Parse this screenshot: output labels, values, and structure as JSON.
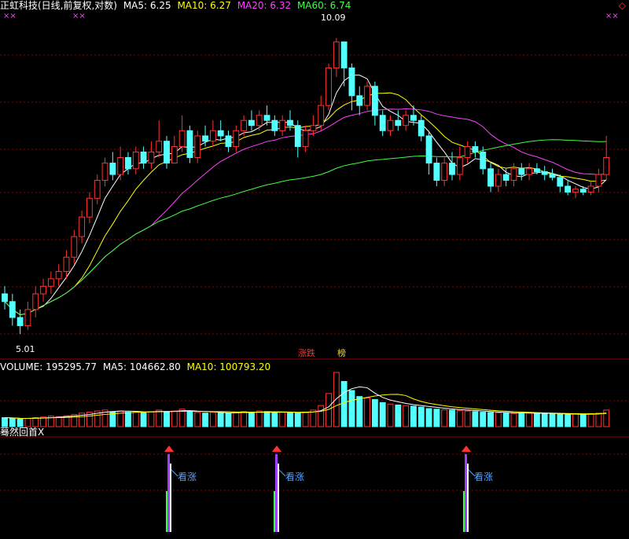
{
  "header": {
    "title": "正虹科技(日线,前复权,对数)",
    "ma": [
      {
        "label": "MA5: 6.25",
        "color": "#ffffff"
      },
      {
        "label": "MA10: 6.27",
        "color": "#ffff00"
      },
      {
        "label": "MA20: 6.32",
        "color": "#ff40ff"
      },
      {
        "label": "MA60: 6.74",
        "color": "#40ff40"
      }
    ],
    "corner_icon": "diamond-icon"
  },
  "price_axis": {
    "high_label": "10.09",
    "low_label": "5.01",
    "ymin": 4.8,
    "ymax": 10.6
  },
  "markers_text": {
    "small_mark": "××"
  },
  "tags": {
    "zhangdie": "涨跌",
    "bang": "榜"
  },
  "volume_header": {
    "volume": "VOLUME: 195295.77",
    "ma5": "MA5: 104662.80",
    "ma10": "MA10: 100793.20"
  },
  "indicator": {
    "name": "蓦然回首X",
    "signal_label": "看涨"
  },
  "colors": {
    "up": "#ff3232",
    "down": "#54ffff",
    "ma5": "#ffffff",
    "ma10": "#ffff00",
    "ma20": "#ff40ff",
    "ma60": "#40ff40",
    "grid": "#8b0000",
    "purple": "#a040ff"
  },
  "chart_data": {
    "type": "candlestick",
    "candles": [
      [
        5.5,
        5.4,
        5.6,
        5.3
      ],
      [
        5.4,
        5.2,
        5.5,
        5.1
      ],
      [
        5.2,
        5.1,
        5.3,
        5.0
      ],
      [
        5.1,
        5.3,
        5.4,
        5.05
      ],
      [
        5.3,
        5.5,
        5.6,
        5.2
      ],
      [
        5.5,
        5.6,
        5.7,
        5.4
      ],
      [
        5.6,
        5.7,
        5.8,
        5.5
      ],
      [
        5.7,
        5.8,
        5.9,
        5.6
      ],
      [
        5.8,
        6.0,
        6.1,
        5.7
      ],
      [
        6.0,
        6.3,
        6.4,
        5.9
      ],
      [
        6.3,
        6.6,
        6.7,
        6.2
      ],
      [
        6.6,
        6.9,
        7.0,
        6.5
      ],
      [
        6.9,
        7.2,
        7.3,
        6.8
      ],
      [
        7.2,
        7.5,
        7.6,
        7.1
      ],
      [
        7.5,
        7.3,
        7.7,
        7.2
      ],
      [
        7.3,
        7.6,
        7.8,
        7.2
      ],
      [
        7.6,
        7.4,
        7.7,
        7.3
      ],
      [
        7.4,
        7.7,
        7.8,
        7.3
      ],
      [
        7.7,
        7.5,
        7.8,
        7.4
      ],
      [
        7.5,
        7.7,
        7.9,
        7.4
      ],
      [
        7.7,
        7.9,
        8.3,
        7.6
      ],
      [
        7.9,
        7.5,
        8.0,
        7.4
      ],
      [
        7.5,
        7.8,
        8.0,
        7.5
      ],
      [
        7.8,
        8.1,
        8.4,
        7.7
      ],
      [
        8.1,
        7.6,
        8.2,
        7.5
      ],
      [
        7.6,
        8.0,
        8.1,
        7.5
      ],
      [
        8.0,
        7.9,
        8.2,
        7.8
      ],
      [
        7.9,
        8.1,
        8.3,
        7.8
      ],
      [
        8.1,
        8.0,
        8.3,
        7.9
      ],
      [
        8.0,
        7.8,
        8.1,
        7.7
      ],
      [
        7.8,
        8.1,
        8.2,
        7.7
      ],
      [
        8.1,
        8.3,
        8.4,
        8.0
      ],
      [
        8.3,
        8.2,
        8.5,
        8.1
      ],
      [
        8.2,
        8.4,
        8.5,
        8.1
      ],
      [
        8.4,
        8.3,
        8.6,
        8.2
      ],
      [
        8.3,
        8.1,
        8.4,
        8.0
      ],
      [
        8.1,
        8.3,
        8.4,
        8.0
      ],
      [
        8.3,
        8.2,
        8.5,
        8.1
      ],
      [
        8.2,
        7.8,
        8.3,
        7.6
      ],
      [
        7.8,
        8.1,
        8.2,
        7.7
      ],
      [
        8.1,
        8.2,
        8.4,
        8.0
      ],
      [
        8.2,
        8.6,
        8.8,
        8.1
      ],
      [
        8.6,
        9.4,
        9.5,
        8.5
      ],
      [
        9.4,
        10.0,
        10.09,
        9.2
      ],
      [
        10.0,
        9.4,
        10.0,
        9.0
      ],
      [
        9.4,
        8.8,
        9.5,
        8.5
      ],
      [
        8.8,
        8.6,
        9.0,
        8.4
      ],
      [
        8.6,
        9.0,
        9.1,
        8.5
      ],
      [
        9.0,
        8.4,
        9.1,
        8.2
      ],
      [
        8.4,
        8.1,
        8.5,
        8.0
      ],
      [
        8.1,
        8.3,
        8.4,
        8.0
      ],
      [
        8.3,
        8.2,
        8.5,
        8.1
      ],
      [
        8.2,
        8.4,
        8.5,
        8.1
      ],
      [
        8.4,
        8.3,
        8.6,
        8.2
      ],
      [
        8.3,
        8.0,
        8.4,
        7.9
      ],
      [
        8.0,
        7.5,
        8.1,
        7.3
      ],
      [
        7.5,
        7.2,
        7.6,
        7.1
      ],
      [
        7.2,
        7.5,
        7.6,
        7.1
      ],
      [
        7.5,
        7.3,
        7.7,
        7.2
      ],
      [
        7.3,
        7.6,
        7.8,
        7.2
      ],
      [
        7.6,
        7.8,
        7.9,
        7.5
      ],
      [
        7.8,
        7.7,
        7.9,
        7.6
      ],
      [
        7.7,
        7.4,
        7.8,
        7.3
      ],
      [
        7.4,
        7.1,
        7.5,
        7.0
      ],
      [
        7.1,
        7.3,
        7.4,
        7.0
      ],
      [
        7.3,
        7.2,
        7.4,
        7.1
      ],
      [
        7.2,
        7.4,
        7.5,
        7.1
      ],
      [
        7.4,
        7.3,
        7.5,
        7.2
      ],
      [
        7.3,
        7.4,
        7.5,
        7.2
      ],
      [
        7.4,
        7.35,
        7.5,
        7.3
      ],
      [
        7.35,
        7.3,
        7.45,
        7.2
      ],
      [
        7.3,
        7.25,
        7.4,
        7.2
      ],
      [
        7.25,
        7.1,
        7.3,
        7.0
      ],
      [
        7.1,
        7.0,
        7.2,
        6.95
      ],
      [
        7.0,
        7.05,
        7.1,
        6.9
      ],
      [
        7.05,
        7.0,
        7.1,
        6.95
      ],
      [
        7.0,
        7.1,
        7.2,
        6.95
      ],
      [
        7.1,
        7.3,
        7.4,
        7.0
      ],
      [
        7.3,
        7.6,
        8.0,
        7.2
      ]
    ],
    "volume": [
      30,
      28,
      25,
      27,
      30,
      32,
      35,
      33,
      36,
      40,
      45,
      48,
      52,
      55,
      50,
      52,
      48,
      50,
      46,
      49,
      55,
      50,
      52,
      58,
      50,
      47,
      45,
      48,
      46,
      44,
      47,
      50,
      48,
      52,
      50,
      46,
      48,
      47,
      45,
      48,
      55,
      70,
      110,
      180,
      150,
      120,
      100,
      95,
      90,
      80,
      75,
      72,
      70,
      68,
      65,
      60,
      58,
      56,
      55,
      54,
      52,
      50,
      48,
      47,
      46,
      45,
      44,
      46,
      45,
      44,
      43,
      42,
      41,
      40,
      42,
      41,
      43,
      45,
      55
    ],
    "signals": [
      17,
      29,
      49
    ]
  }
}
